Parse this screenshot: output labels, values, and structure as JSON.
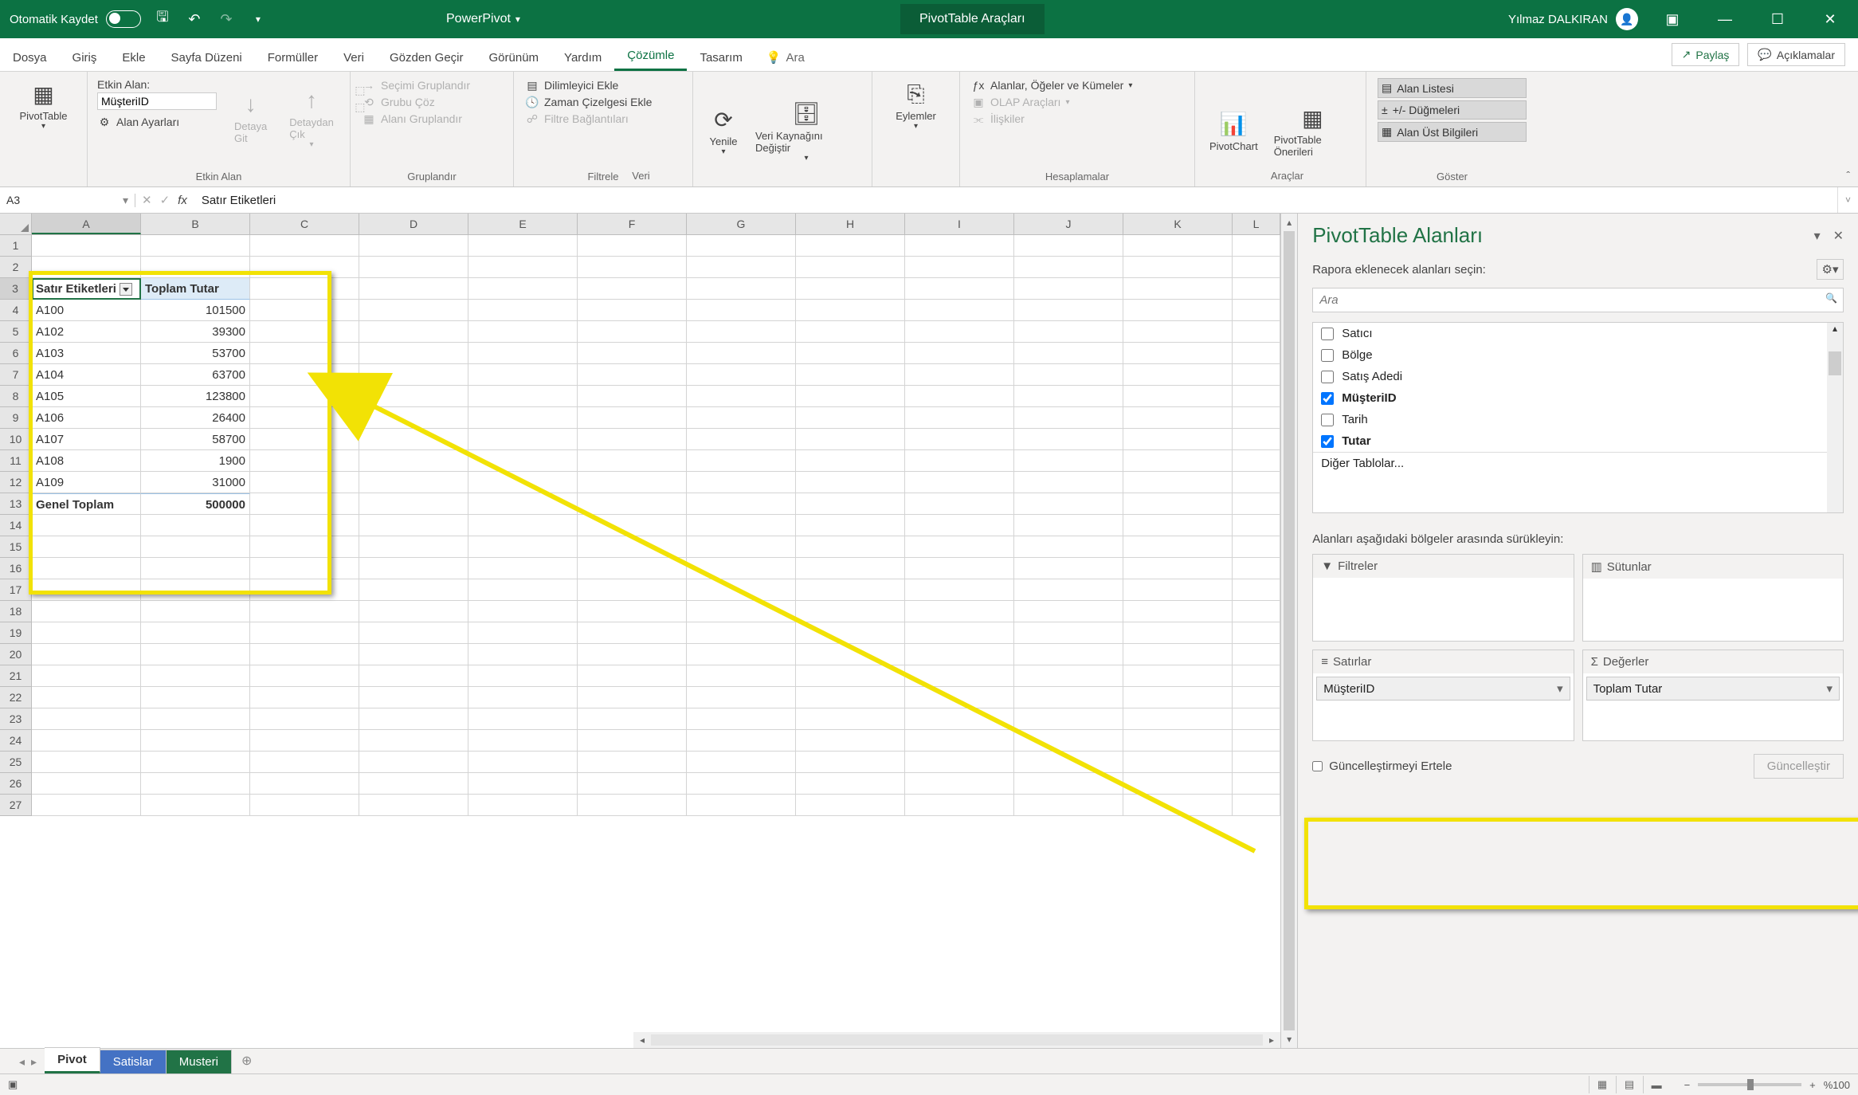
{
  "titlebar": {
    "autosave_label": "Otomatik Kaydet",
    "doc_title": "PowerPivot",
    "context_tab": "PivotTable Araçları",
    "user_name": "Yılmaz DALKIRAN"
  },
  "ribbon_tabs": {
    "items": [
      "Dosya",
      "Giriş",
      "Ekle",
      "Sayfa Düzeni",
      "Formüller",
      "Veri",
      "Gözden Geçir",
      "Görünüm",
      "Yardım",
      "Çözümle",
      "Tasarım"
    ],
    "active": "Çözümle",
    "search": "Ara",
    "share": "Paylaş",
    "comments": "Açıklamalar"
  },
  "ribbon": {
    "pivottable": {
      "label": "PivotTable",
      "group": ""
    },
    "active_field": {
      "label": "Etkin Alan:",
      "value": "MüşteriID",
      "settings": "Alan Ayarları",
      "drill_down": "Detaya Git",
      "drill_up": "Detaydan Çık",
      "group": "Etkin Alan"
    },
    "group": {
      "sel": "Seçimi Gruplandır",
      "ungroup": "Grubu Çöz",
      "field": "Alanı Gruplandır",
      "group": "Gruplandır"
    },
    "filter": {
      "slicer": "Dilimleyici Ekle",
      "timeline": "Zaman Çizelgesi Ekle",
      "conn": "Filtre Bağlantıları",
      "group": "Filtrele"
    },
    "data": {
      "refresh": "Yenile",
      "change_src": "Veri Kaynağını Değiştir",
      "group": "Veri"
    },
    "actions": {
      "label": "Eylemler",
      "group": ""
    },
    "calc": {
      "fields": "Alanlar, Öğeler ve Kümeler",
      "olap": "OLAP Araçları",
      "rel": "İlişkiler",
      "group": "Hesaplamalar"
    },
    "tools": {
      "chart": "PivotChart",
      "rec": "PivotTable Önerileri",
      "group": "Araçlar"
    },
    "show": {
      "fl": "Alan Listesi",
      "pm": "+/- Düğmeleri",
      "fh": "Alan Üst Bilgileri",
      "group": "Göster"
    }
  },
  "formula_bar": {
    "name_box": "A3",
    "value": "Satır Etiketleri"
  },
  "columns": [
    "A",
    "B",
    "C",
    "D",
    "E",
    "F",
    "G",
    "H",
    "I",
    "J",
    "K",
    "L"
  ],
  "pivot": {
    "header_row": "Satır Etiketleri",
    "header_val": "Toplam Tutar",
    "rows": [
      {
        "k": "A100",
        "v": "101500"
      },
      {
        "k": "A102",
        "v": "39300"
      },
      {
        "k": "A103",
        "v": "53700"
      },
      {
        "k": "A104",
        "v": "63700"
      },
      {
        "k": "A105",
        "v": "123800"
      },
      {
        "k": "A106",
        "v": "26400"
      },
      {
        "k": "A107",
        "v": "58700"
      },
      {
        "k": "A108",
        "v": "1900"
      },
      {
        "k": "A109",
        "v": "31000"
      }
    ],
    "total_label": "Genel Toplam",
    "total_value": "500000"
  },
  "pane": {
    "title": "PivotTable Alanları",
    "choose": "Rapora eklenecek alanları seçin:",
    "search": "Ara",
    "fields": [
      {
        "name": "Satıcı",
        "checked": false
      },
      {
        "name": "Bölge",
        "checked": false
      },
      {
        "name": "Satış Adedi",
        "checked": false
      },
      {
        "name": "MüşteriID",
        "checked": true
      },
      {
        "name": "Tarih",
        "checked": false
      },
      {
        "name": "Tutar",
        "checked": true
      }
    ],
    "more": "Diğer Tablolar...",
    "drag_label": "Alanları aşağıdaki bölgeler arasında sürükleyin:",
    "areas": {
      "filters": "Filtreler",
      "columns": "Sütunlar",
      "rows": "Satırlar",
      "values": "Değerler",
      "rows_item": "MüşteriID",
      "values_item": "Toplam Tutar"
    },
    "defer": "Güncelleştirmeyi Ertele",
    "update": "Güncelleştir"
  },
  "sheets": {
    "tabs": [
      "Pivot",
      "Satislar",
      "Musteri"
    ],
    "active": "Pivot"
  },
  "status": {
    "zoom": "%100"
  }
}
